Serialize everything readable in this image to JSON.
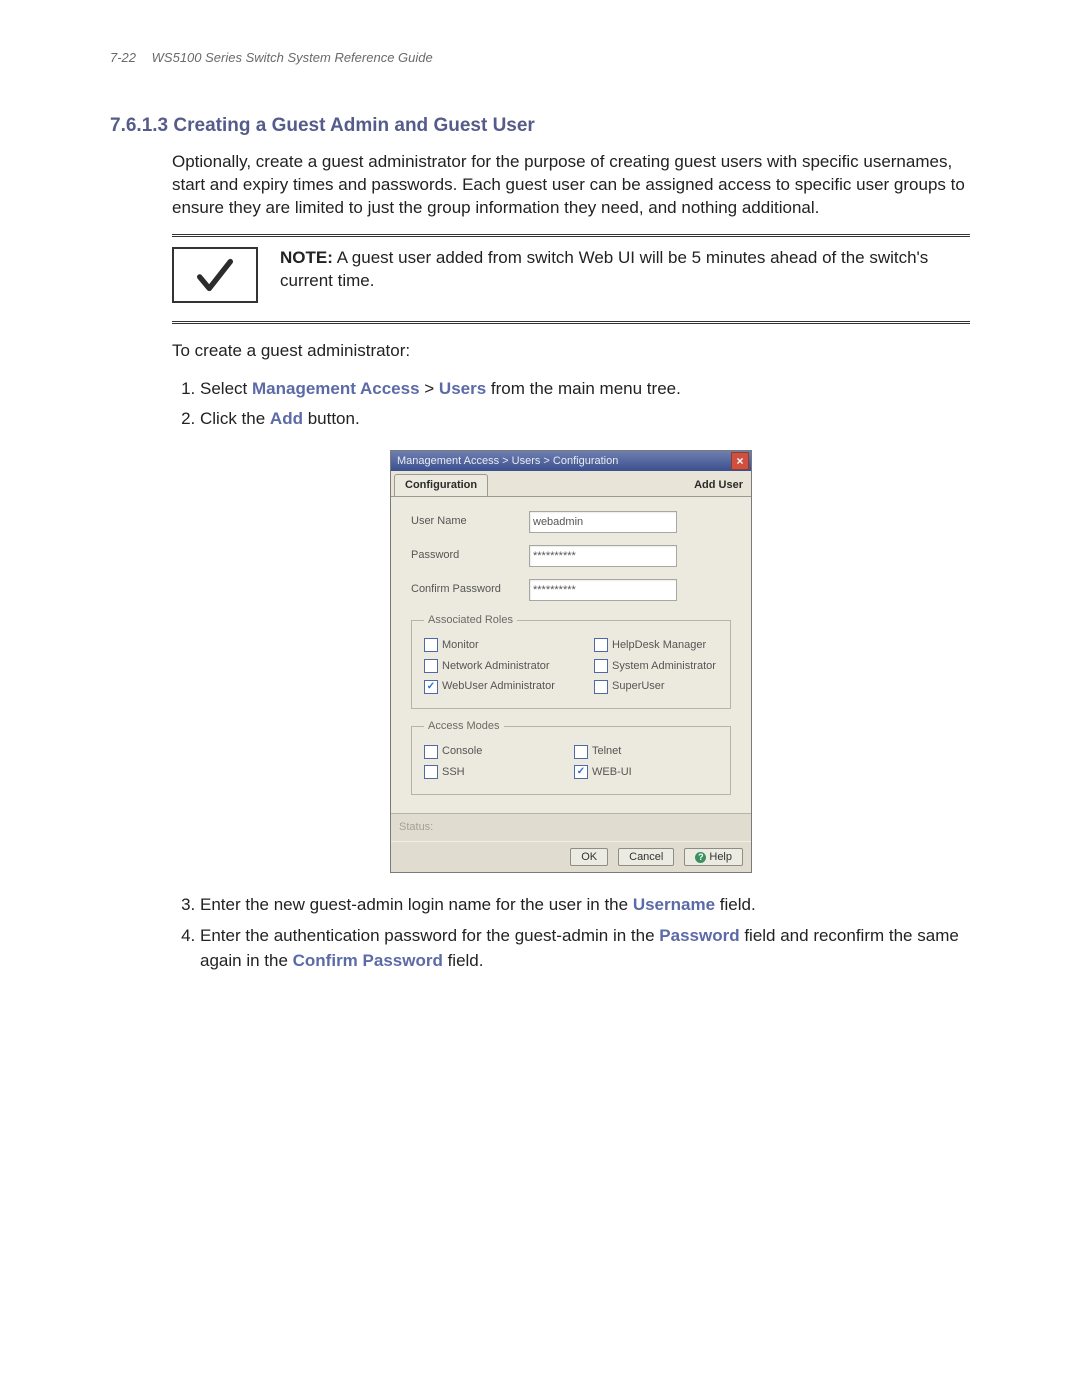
{
  "page": {
    "number": "7-22",
    "running_head": "WS5100 Series Switch System Reference Guide"
  },
  "section": {
    "number": "7.6.1.3",
    "title": "Creating a Guest Admin and Guest User",
    "intro": "Optionally, create a guest administrator for the purpose of creating guest users with specific usernames, start and expiry times and passwords. Each guest user can be assigned access to specific user groups to ensure they are limited to just the group information they need, and nothing additional."
  },
  "note": {
    "label": "NOTE:",
    "text": "A guest user added from switch Web UI will be 5 minutes ahead of the switch's current time."
  },
  "lead_in": "To create a guest administrator:",
  "steps": {
    "s1_a": "Select ",
    "s1_kw1": "Management Access",
    "s1_sep": " > ",
    "s1_kw2": "Users",
    "s1_b": " from the main menu tree.",
    "s2_a": "Click the ",
    "s2_kw": "Add",
    "s2_b": " button.",
    "s3_a": "Enter the new guest-admin login name for the user in the ",
    "s3_kw": "Username",
    "s3_b": " field.",
    "s4_a": "Enter the authentication password for the guest-admin in the ",
    "s4_kw1": "Password",
    "s4_mid": " field and reconfirm the same again in the ",
    "s4_kw2": "Confirm Password",
    "s4_b": " field."
  },
  "dialog": {
    "breadcrumb": "Management Access > Users > Configuration",
    "tab_label": "Configuration",
    "heading_right": "Add User",
    "fields": {
      "username_label": "User Name",
      "username_value": "webadmin",
      "password_label": "Password",
      "password_value": "**********",
      "confirm_label": "Confirm Password",
      "confirm_value": "**********"
    },
    "roles_legend": "Associated Roles",
    "roles": {
      "monitor": "Monitor",
      "helpdesk": "HelpDesk Manager",
      "netadmin": "Network Administrator",
      "sysadmin": "System Administrator",
      "webuser": "WebUser Administrator",
      "superuser": "SuperUser"
    },
    "access_legend": "Access Modes",
    "access": {
      "console": "Console",
      "telnet": "Telnet",
      "ssh": "SSH",
      "webui": "WEB-UI"
    },
    "status_label": "Status:",
    "buttons": {
      "ok": "OK",
      "cancel": "Cancel",
      "help": "Help"
    }
  }
}
